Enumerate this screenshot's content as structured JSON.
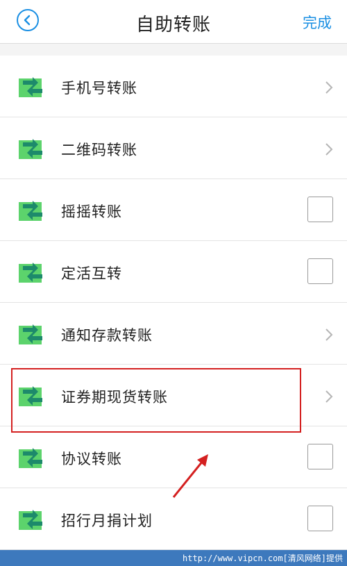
{
  "header": {
    "title": "自助转账",
    "done_label": "完成"
  },
  "items": [
    {
      "label": "手机号转账",
      "control": "chevron"
    },
    {
      "label": "二维码转账",
      "control": "chevron"
    },
    {
      "label": "摇摇转账",
      "control": "checkbox",
      "checked": false
    },
    {
      "label": "定活互转",
      "control": "checkbox",
      "checked": false
    },
    {
      "label": "通知存款转账",
      "control": "chevron"
    },
    {
      "label": "证券期现货转账",
      "control": "chevron"
    },
    {
      "label": "协议转账",
      "control": "checkbox",
      "checked": false
    },
    {
      "label": "招行月捐计划",
      "control": "checkbox",
      "checked": false
    }
  ],
  "watermark": "http://www.vipcn.com[清风网络]提供",
  "colors": {
    "accent": "#1a8fe3",
    "highlight": "#d42020",
    "icon_green": "#34b54a"
  }
}
